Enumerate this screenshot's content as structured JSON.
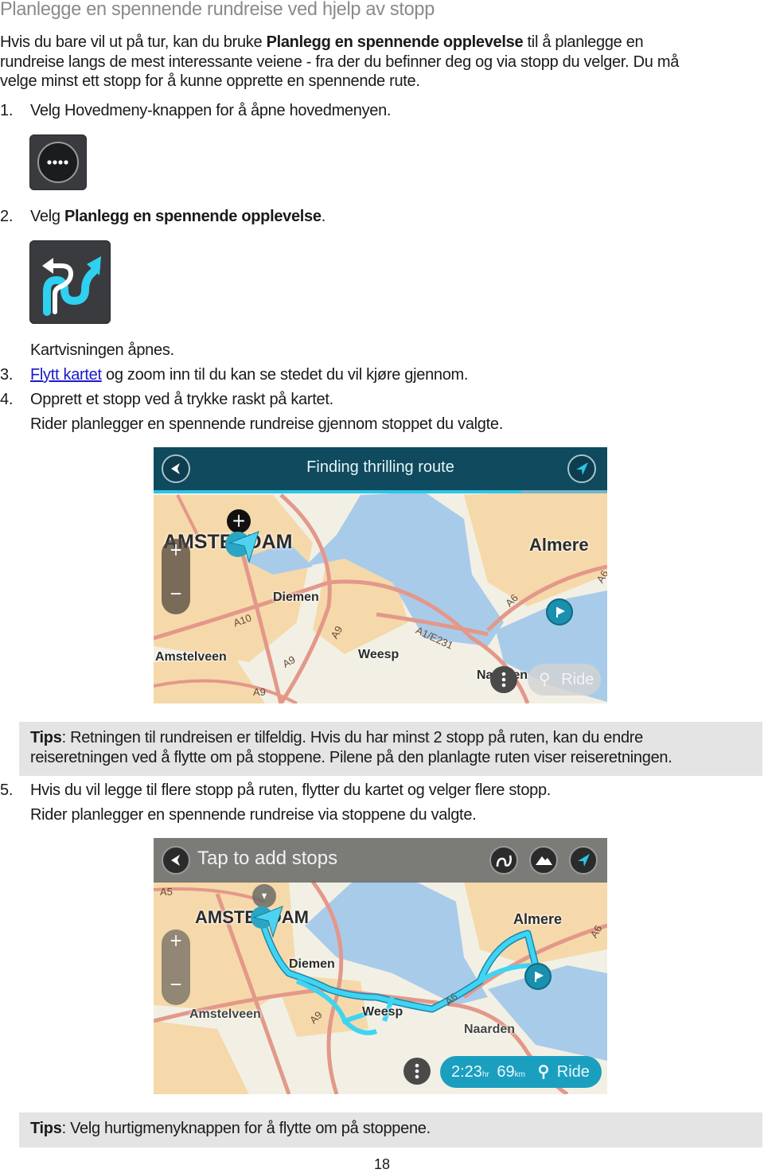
{
  "heading": "Planlegge en spennende rundreise ved hjelp av stopp",
  "intro": {
    "part1": "Hvis du bare vil ut på tur, kan du bruke ",
    "bold": "Planlegg en spennende opplevelse",
    "part2": " til å planlegge en",
    "line2": "rundreise langs de mest interessante veiene - fra der du befinner deg og via stopp du velger. Du må",
    "line3": "velge minst ett stopp for å kunne opprette en spennende rute."
  },
  "steps": [
    {
      "num": "1.",
      "text": "Velg Hovedmeny-knappen for å åpne hovedmenyen."
    },
    {
      "num": "2.",
      "pre": "Velg ",
      "bold": "Planlegg en spennende opplevelse",
      "post": "."
    },
    {
      "num": "3.",
      "link": "Flytt kartet",
      "post": " og zoom inn til du kan se stedet du vil kjøre gjennom."
    },
    {
      "num": "4.",
      "text": "Opprett et stopp ved å trykke raskt på kartet."
    },
    {
      "num": "5.",
      "text": "Hvis du vil legge til flere stopp på ruten, flytter du kartet og velger flere stopp."
    }
  ],
  "notes": {
    "after_step2": "Kartvisningen åpnes.",
    "after_step4": "Rider planlegger en spennende rundreise gjennom stoppet du valgte.",
    "after_step5": "Rider planlegger en spennende rundreise via stoppene du valgte."
  },
  "icons": {
    "main_menu": "main-menu-icon",
    "thrilling_route": "thrilling-route-icon"
  },
  "screenshot1": {
    "header_title": "Finding thrilling route",
    "progress": 0.81,
    "labels": {
      "amsterdam": "AMSTERDAM",
      "almere": "Almere",
      "diemen": "Diemen",
      "amstelveen": "Amstelveen",
      "weesp": "Weesp",
      "naarden": "Naarden"
    },
    "roads": [
      "A10",
      "A9",
      "A9",
      "A9",
      "A1/E231",
      "A6",
      "A6"
    ],
    "ride_label": "Ride"
  },
  "tips1": {
    "label": "Tips",
    "text": ": Retningen til rundreisen er tilfeldig. Hvis du har minst 2 stopp på ruten, kan du endre",
    "line2": "reiseretningen ved å flytte om på stoppene. Pilene på den planlagte ruten viser reiseretningen."
  },
  "screenshot2": {
    "header_title": "Tap to add stops",
    "labels": {
      "amsterdam": "AMSTERDAM",
      "almere": "Almere",
      "diemen": "Diemen",
      "amstelveen": "Amstelveen",
      "weesp": "Weesp",
      "naarden": "Naarden"
    },
    "roads": [
      "A5",
      "A9",
      "A6",
      "A6"
    ],
    "duration": "2:23",
    "duration_unit": "hr",
    "distance": "69",
    "distance_unit": "km",
    "ride_label": "Ride"
  },
  "tips2": {
    "label": "Tips",
    "text": ": Velg hurtigmenyknappen for å flytte om på stoppene."
  },
  "colors": {
    "header_teal": "#0f4a5e",
    "accent_cyan": "#2bc6e8",
    "ride_button": "#1a9fbf",
    "water": "#a9cbea",
    "urban": "#f6d9aa",
    "road": "#e3988a"
  },
  "page_number": "18"
}
